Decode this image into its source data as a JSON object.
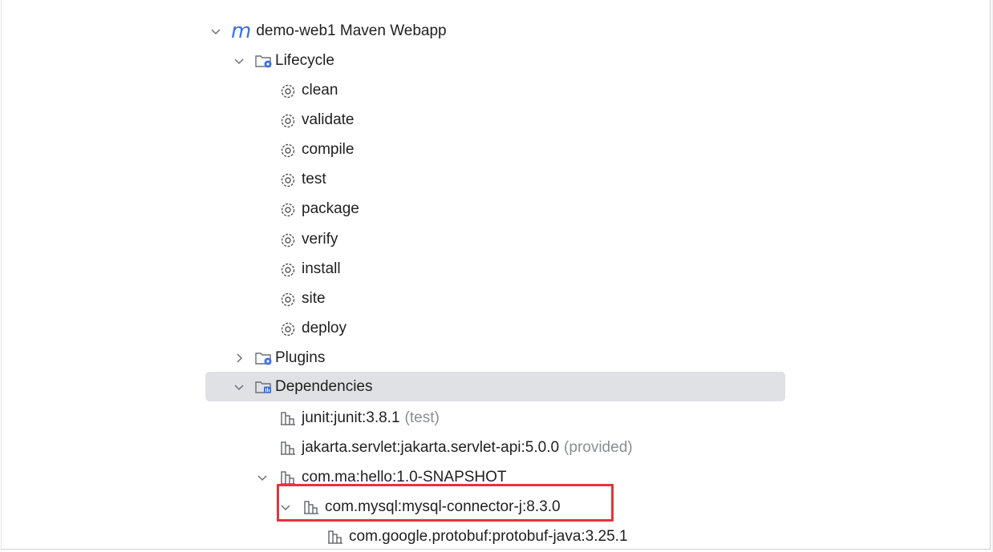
{
  "tree": {
    "project": {
      "icon": "maven-m-icon",
      "label": "demo-web1 Maven Webapp",
      "expanded": true
    },
    "lifecycle": {
      "label": "Lifecycle",
      "icon": "lifecycle-folder-icon",
      "expanded": true,
      "goals": [
        "clean",
        "validate",
        "compile",
        "test",
        "package",
        "verify",
        "install",
        "site",
        "deploy"
      ]
    },
    "plugins": {
      "label": "Plugins",
      "icon": "plugins-folder-icon",
      "expanded": false
    },
    "dependencies": {
      "label": "Dependencies",
      "icon": "dependencies-folder-icon",
      "expanded": true,
      "selected": true,
      "items": [
        {
          "label": "junit:junit:3.8.1",
          "scope": "(test)"
        },
        {
          "label": "jakarta.servlet:jakarta.servlet-api:5.0.0",
          "scope": "(provided)"
        },
        {
          "label": "com.ma:hello:1.0-SNAPSHOT",
          "scope": ""
        },
        {
          "label": "com.mysql:mysql-connector-j:8.3.0",
          "scope": ""
        },
        {
          "label": "com.google.protobuf:protobuf-java:3.25.1",
          "scope": ""
        }
      ]
    }
  },
  "colors": {
    "selection_bg": "#dfe1e5",
    "highlight_border": "#e2343b",
    "maven_blue": "#3b73e7",
    "muted_text": "#8a8d93"
  }
}
